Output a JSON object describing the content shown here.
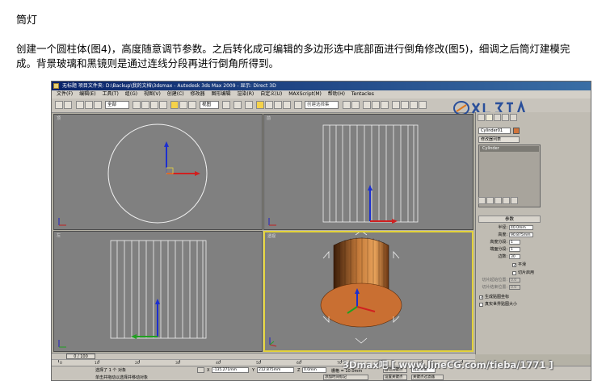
{
  "article": {
    "title": "筒灯",
    "paragraph": "创建一个圆柱体(图4)，高度随意调节参数。之后转化成可编辑的多边形选中底部面进行倒角修改(图5)，细调之后筒灯建模完成。背景玻璃和黑镜则是通过连线分段再进行倒角所得到。"
  },
  "window": {
    "title": "无标题    项目文件夹: D:\\Backup\\我的文档\\3dsmax    - Autodesk 3ds Max 2009    - 显示: Direct 3D",
    "menus": [
      "文件(F)",
      "编辑(E)",
      "工具(T)",
      "组(G)",
      "视图(V)",
      "创建(C)",
      "修改器",
      "图形编辑",
      "渲染(R)",
      "自定义(U)",
      "MAXScript(M)",
      "帮助(H)",
      "Tentacles"
    ],
    "toolbar_select_filter": "全部",
    "toolbar_view": "视图",
    "toolbar_named_selection": "创建选择集"
  },
  "viewports": {
    "top": "顶",
    "front": "前",
    "left": "左",
    "perspective": "透视"
  },
  "command_panel": {
    "object_name": "Cylinder01",
    "modifier_list": "修改器列表",
    "stack_item": "Cylinder",
    "rollout_title": "参数",
    "params": [
      {
        "label": "半径:",
        "value": "40.0mm",
        "disabled": false
      },
      {
        "label": "高度:",
        "value": "90.875mm",
        "disabled": false
      },
      {
        "label": "高度分段:",
        "value": "1",
        "disabled": false
      },
      {
        "label": "端面分段:",
        "value": "1",
        "disabled": false
      },
      {
        "label": "边数:",
        "value": "30",
        "disabled": false
      }
    ],
    "smooth": "平滑",
    "slice_on": "切片启用",
    "slice_from_label": "切片起始位置:",
    "slice_from": "0.0",
    "slice_to_label": "切片结束位置:",
    "slice_to": "0.0",
    "gen_map_coords": "生成贴图坐标",
    "real_world_map": "真实世界贴图大小",
    "object_color": "#d2743a"
  },
  "timeline": {
    "frame": "0 / 100",
    "ticks": [
      "0",
      "10",
      "20",
      "30",
      "40",
      "50",
      "60",
      "70",
      "80",
      "90",
      "100"
    ]
  },
  "status": {
    "selected": "选择了 1 个 对象",
    "prompt": "单击并拖动以选择并移动对象",
    "x_label": "X",
    "x_value": "-135.271mm",
    "y_label": "Y",
    "y_value": "212.875mm",
    "z_label": "Z",
    "z_value": "0.0mm",
    "grid_label": "栅格 = 10.0mm",
    "add_time_tag": "添加时间标记",
    "auto_key": "自动关键点",
    "selected_obj": "选定对象",
    "set_key": "设置关键点",
    "key_filter": "关键点过滤器"
  },
  "watermark": "3Dmax吧 [ www.lineCG.com/tieba/1771 ]"
}
